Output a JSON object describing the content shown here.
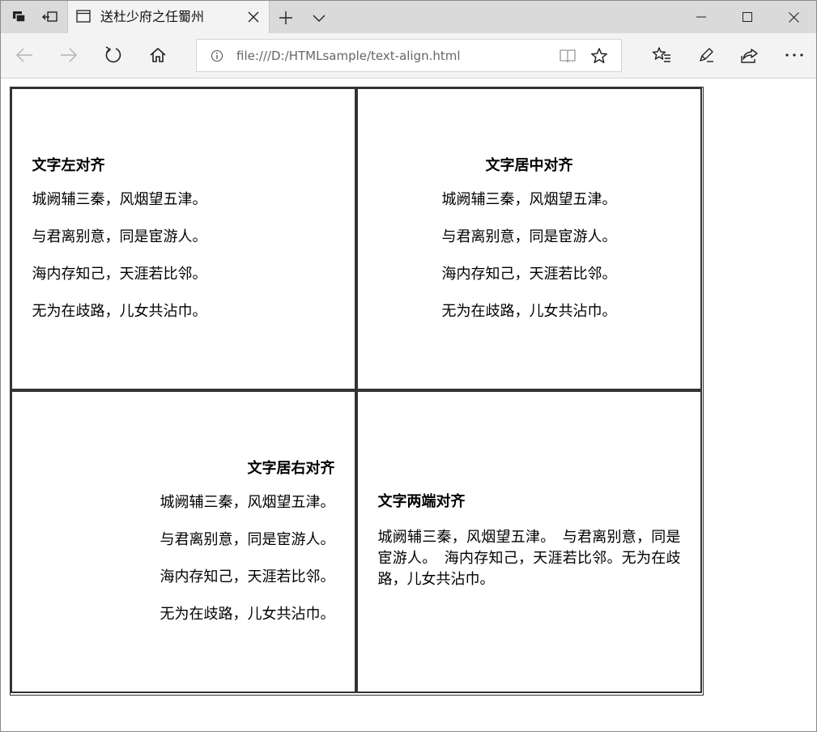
{
  "tab": {
    "title": "送杜少府之任蜀州"
  },
  "address": {
    "url": "file:///D:/HTMLsample/text-align.html"
  },
  "cells": [
    {
      "heading": "文字左对齐",
      "lines": [
        "城阙辅三秦，风烟望五津。",
        "与君离别意，同是宦游人。",
        "海内存知己，天涯若比邻。",
        "无为在歧路，儿女共沾巾。"
      ]
    },
    {
      "heading": "文字居中对齐",
      "lines": [
        "城阙辅三秦，风烟望五津。",
        "与君离别意，同是宦游人。",
        "海内存知己，天涯若比邻。",
        "无为在歧路，儿女共沾巾。"
      ]
    },
    {
      "heading": "文字居右对齐",
      "lines": [
        "城阙辅三秦，风烟望五津。",
        "与君离别意，同是宦游人。",
        "海内存知己，天涯若比邻。",
        "无为在歧路，儿女共沾巾。"
      ]
    },
    {
      "heading": "文字两端对齐",
      "text": "城阙辅三秦，风烟望五津。　与君离别意，同是宦游人。　海内存知己，天涯若比邻。无为在歧路，儿女共沾巾。"
    }
  ],
  "icons": {
    "set_aside": "tabs-set-aside-icon",
    "restore": "restore-tabs-icon",
    "favicon": "page-favicon-icon",
    "close_tab": "close-icon",
    "new_tab": "plus-icon",
    "tab_menu": "chevron-down-icon",
    "minimize": "minimize-icon",
    "maximize": "maximize-icon",
    "close_window": "close-window-icon",
    "back": "back-arrow-icon",
    "forward": "forward-arrow-icon",
    "refresh": "refresh-icon",
    "home": "home-icon",
    "info": "info-icon",
    "reading_view": "reading-view-icon",
    "favorite": "star-icon",
    "favorites": "favorites-icon",
    "notes": "pen-icon",
    "share": "share-icon",
    "more": "more-icon"
  }
}
